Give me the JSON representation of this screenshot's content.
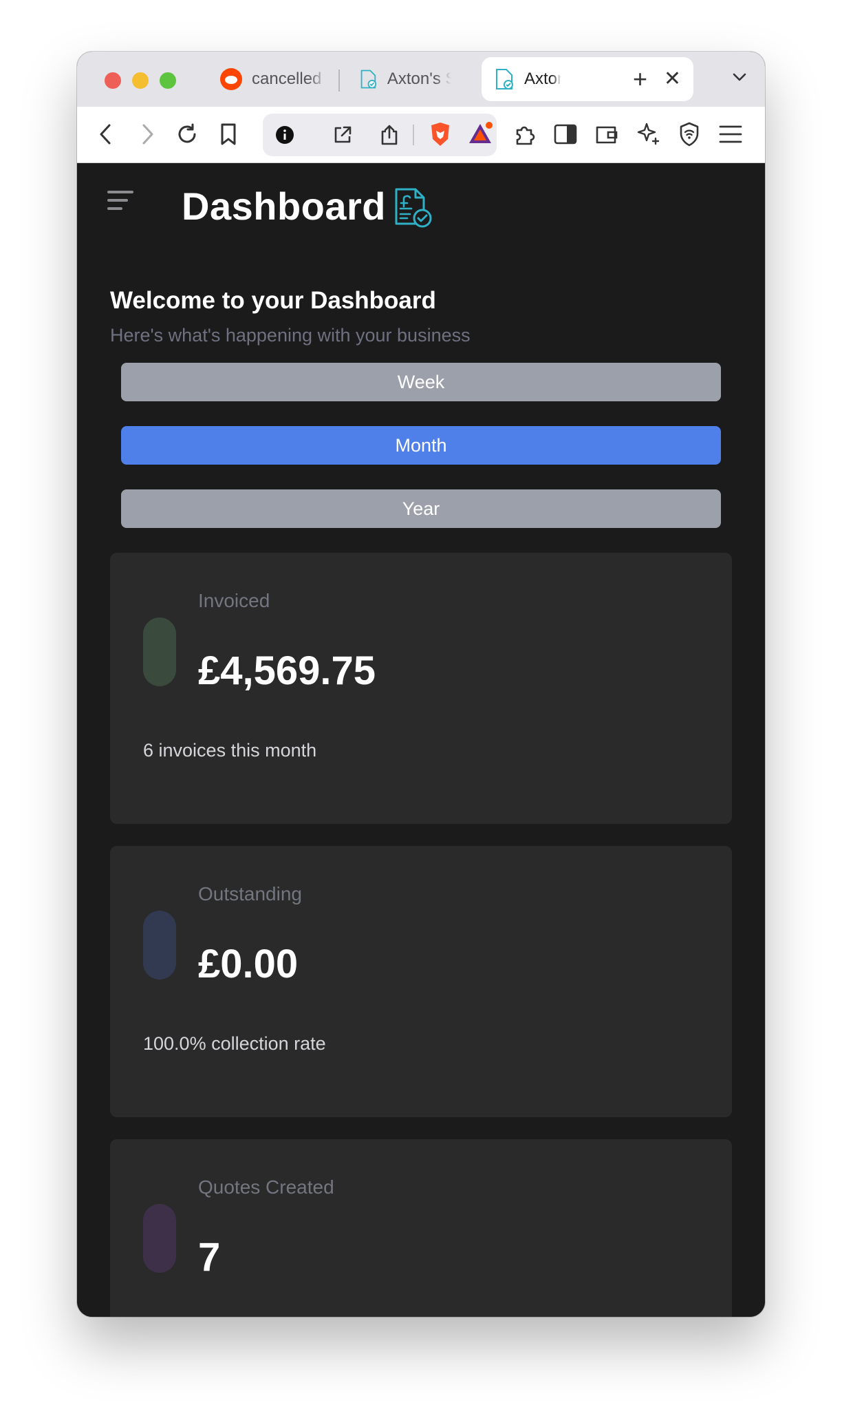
{
  "browser": {
    "tabs": [
      {
        "label": "cancelled"
      },
      {
        "label": "Axton's S"
      },
      {
        "label": "Axton's S",
        "active": true
      }
    ],
    "close_glyph": "✕",
    "new_tab_glyph": "+"
  },
  "header": {
    "title": "Dashboard",
    "logo_icon": "invoice-pound-check-icon"
  },
  "welcome": {
    "title": "Welcome to your Dashboard",
    "subtitle": "Here's what's happening with your business"
  },
  "periods": {
    "week": "Week",
    "month": "Month",
    "year": "Year",
    "selected": "Month"
  },
  "cards": [
    {
      "label": "Invoiced",
      "value": "£4,569.75",
      "note": "6 invoices this month",
      "accent": "#3a4a3c"
    },
    {
      "label": "Outstanding",
      "value": "£0.00",
      "note": "100.0% collection rate",
      "accent": "#323a52"
    },
    {
      "label": "Quotes Created",
      "value": "7",
      "note": "",
      "accent": "#3f3049"
    }
  ],
  "colors": {
    "page_bg": "#1b1b1c",
    "card_bg": "#2a2a2b",
    "accent_blue": "#4f80ea",
    "button_gray": "#9ca0aa",
    "logo_teal": "#2fb0c6"
  }
}
